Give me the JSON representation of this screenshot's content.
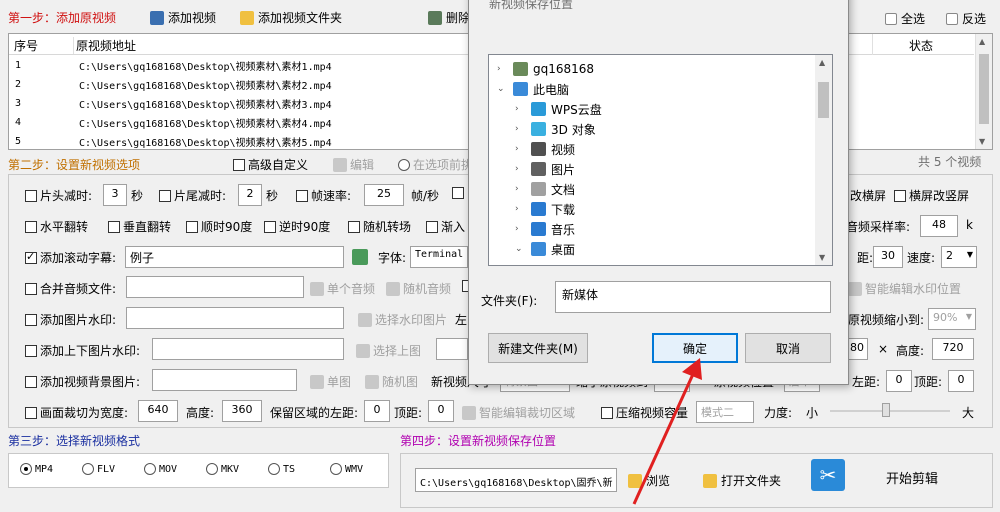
{
  "step1": {
    "title": "第一步：添加原视频",
    "add_video": "添加视频",
    "add_folder": "添加视频文件夹",
    "delete": "删除",
    "select_all": "全选",
    "invert": "反选",
    "col_index": "序号",
    "col_path": "原视频地址",
    "col_status": "状态",
    "rows": [
      {
        "idx": "1",
        "path": "C:\\Users\\gq168168\\Desktop\\视频素材\\素材1.mp4"
      },
      {
        "idx": "2",
        "path": "C:\\Users\\gq168168\\Desktop\\视频素材\\素材2.mp4"
      },
      {
        "idx": "3",
        "path": "C:\\Users\\gq168168\\Desktop\\视频素材\\素材3.mp4"
      },
      {
        "idx": "4",
        "path": "C:\\Users\\gq168168\\Desktop\\视频素材\\素材4.mp4"
      },
      {
        "idx": "5",
        "path": "C:\\Users\\gq168168\\Desktop\\视频素材\\素材5.mp4"
      }
    ],
    "count": "共 5 个视频"
  },
  "step2": {
    "title": "第二步：设置新视频选项",
    "advanced": "高级自定义",
    "edit": "编辑",
    "before": "在选项前挑",
    "cut_head": "片头减时:",
    "cut_head_val": "3",
    "sec1": "秒",
    "cut_tail": "片尾减时:",
    "cut_tail_val": "2",
    "sec2": "秒",
    "framerate": "帧速率:",
    "framerate_val": "25",
    "fps": "帧/秒",
    "to_landscape": "改横屏",
    "to_portrait": "横屏改竖屏",
    "hflip": "水平翻转",
    "vflip": "垂直翻转",
    "rot90cw": "顺时90度",
    "rot90ccw": "逆时90度",
    "random_rot": "随机转场",
    "fade": "渐入",
    "audio_rate": "音频采样率:",
    "audio_rate_val": "48",
    "audio_rate_unit": "k",
    "subtitle": "添加滚动字幕:",
    "subtitle_val": "例子",
    "font": "字体:",
    "font_val": "Terminal",
    "spacing": "距:",
    "spacing_val": "30",
    "speed": "速度:",
    "speed_val": "2",
    "merge_audio": "合并音频文件:",
    "single_audio": "单个音频",
    "random_audio": "随机音频",
    "smart_wm": "智能编辑水印位置",
    "img_wm": "添加图片水印:",
    "select_wm": "选择水印图片",
    "left": "左",
    "shrink_to": "原视频缩小到:",
    "shrink_val": "90%",
    "updown_wm": "添加上下图片水印:",
    "select_up": "选择上图",
    "width_val": "80",
    "height": "高度:",
    "height_val": "720",
    "bg_img": "添加视频背景图片:",
    "single_img": "单图",
    "random_img": "随机图",
    "new_size": "新视频尺寸",
    "bg_choice": "背景图",
    "shrink_by": "缩小原视频到",
    "shrink_by_val": "90%",
    "orig_pos": "原视频位置",
    "pos_val": "居中",
    "left_dist": "左距:",
    "left_dist_val": "0",
    "top_dist": "顶距:",
    "top_dist_val": "0",
    "crop": "画面裁切为宽度:",
    "crop_w": "640",
    "crop_h_lbl": "高度:",
    "crop_h": "360",
    "keep_left": "保留区域的左距:",
    "keep_left_val": "0",
    "keep_top": "顶距:",
    "keep_top_val": "0",
    "smart_crop": "智能编辑裁切区域",
    "compress": "压缩视频容量",
    "mode": "模式二",
    "strength": "力度:",
    "small": "小",
    "large": "大"
  },
  "step3": {
    "title": "第三步：选择新视频格式",
    "formats": [
      "MP4",
      "FLV",
      "MOV",
      "MKV",
      "TS",
      "WMV"
    ],
    "selected": "MP4"
  },
  "step4": {
    "title": "第四步：设置新视频保存位置",
    "path": "C:\\Users\\gq168168\\Desktop\\固乔\\新",
    "browse": "浏览",
    "open_folder": "打开文件夹",
    "start": "开始剪辑"
  },
  "dialog": {
    "title": "新视频保存位置",
    "tree": [
      {
        "label": "gq168168",
        "icon": "user-icon",
        "level": 0,
        "expanded": false
      },
      {
        "label": "此电脑",
        "icon": "computer-icon",
        "level": 0,
        "expanded": true
      },
      {
        "label": "WPS云盘",
        "icon": "cloud-icon",
        "level": 1,
        "expanded": false
      },
      {
        "label": "3D 对象",
        "icon": "cube-icon",
        "level": 1,
        "expanded": false
      },
      {
        "label": "视频",
        "icon": "video-folder-icon",
        "level": 1,
        "expanded": false
      },
      {
        "label": "图片",
        "icon": "picture-folder-icon",
        "level": 1,
        "expanded": false
      },
      {
        "label": "文档",
        "icon": "document-folder-icon",
        "level": 1,
        "expanded": false
      },
      {
        "label": "下载",
        "icon": "download-folder-icon",
        "level": 1,
        "expanded": false
      },
      {
        "label": "音乐",
        "icon": "music-folder-icon",
        "level": 1,
        "expanded": false
      },
      {
        "label": "桌面",
        "icon": "desktop-folder-icon",
        "level": 1,
        "expanded": true
      }
    ],
    "folder_label": "文件夹(F):",
    "folder_val": "新媒体",
    "new_folder": "新建文件夹(M)",
    "ok": "确定",
    "cancel": "取消"
  },
  "colors": {
    "step_red": "#d01010",
    "step_blue": "#1a2fa0",
    "step_magenta": "#b000b0",
    "arrow": "#e02020",
    "ok_border": "#0078d7"
  }
}
